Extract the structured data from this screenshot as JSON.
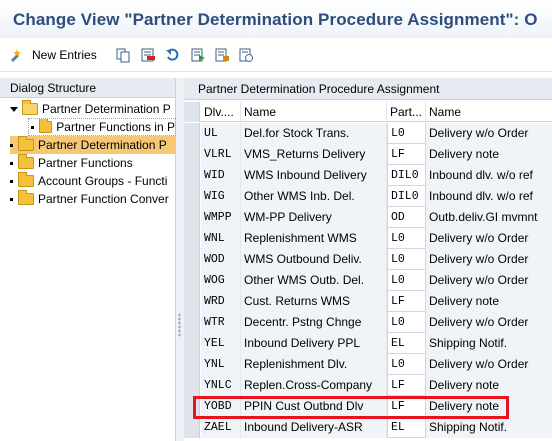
{
  "window": {
    "title": "Change View \"Partner Determination Procedure Assignment\": O"
  },
  "toolbar": {
    "new_entries_label": "New Entries",
    "icons": [
      "new-entries-icon",
      "copy-icon",
      "delete-icon",
      "undo-icon",
      "select-all-icon",
      "deselect-all-icon",
      "block-icon"
    ]
  },
  "dialog_structure": {
    "header": "Dialog Structure",
    "items": [
      {
        "label": "Partner Determination P",
        "level": 0,
        "expanded": true,
        "selected": false
      },
      {
        "label": "Partner Functions in P",
        "level": 1,
        "expanded": false,
        "selected": false
      },
      {
        "label": "Partner Determination P",
        "level": 0,
        "expanded": false,
        "selected": true
      },
      {
        "label": "Partner Functions",
        "level": 0,
        "expanded": false,
        "selected": false
      },
      {
        "label": "Account Groups - Functi",
        "level": 0,
        "expanded": false,
        "selected": false
      },
      {
        "label": "Partner Function Conver",
        "level": 0,
        "expanded": false,
        "selected": false
      }
    ]
  },
  "panel": {
    "header": "Partner Determination Procedure Assignment"
  },
  "table": {
    "columns": [
      "Dlv....",
      "Name",
      "Part...",
      "Name"
    ],
    "rows": [
      {
        "dlv": "UL",
        "name": "Del.for Stock Trans.",
        "part": "L0",
        "pname": "Delivery w/o Order"
      },
      {
        "dlv": "VLRL",
        "name": "VMS_Returns Delivery",
        "part": "LF",
        "pname": "Delivery note"
      },
      {
        "dlv": "WID",
        "name": "WMS Inbound Delivery",
        "part": "DIL0",
        "pname": "Inbound dlv. w/o ref"
      },
      {
        "dlv": "WIG",
        "name": "Other WMS Inb. Del.",
        "part": "DIL0",
        "pname": "Inbound dlv. w/o ref"
      },
      {
        "dlv": "WMPP",
        "name": "WM-PP Delivery",
        "part": "OD",
        "pname": "Outb.deliv.GI mvmnt"
      },
      {
        "dlv": "WNL",
        "name": "Replenishment WMS",
        "part": "L0",
        "pname": "Delivery w/o Order"
      },
      {
        "dlv": "WOD",
        "name": "WMS Outbound Deliv.",
        "part": "L0",
        "pname": "Delivery w/o Order"
      },
      {
        "dlv": "WOG",
        "name": "Other WMS Outb. Del.",
        "part": "L0",
        "pname": "Delivery w/o Order"
      },
      {
        "dlv": "WRD",
        "name": "Cust. Returns WMS",
        "part": "LF",
        "pname": "Delivery note"
      },
      {
        "dlv": "WTR",
        "name": "Decentr. Pstng Chnge",
        "part": "L0",
        "pname": "Delivery w/o Order"
      },
      {
        "dlv": "YEL",
        "name": "Inbound Delivery PPL",
        "part": "EL",
        "pname": "Shipping Notif."
      },
      {
        "dlv": "YNL",
        "name": "Replenishment Dlv.",
        "part": "L0",
        "pname": "Delivery w/o Order"
      },
      {
        "dlv": "YNLC",
        "name": "Replen.Cross-Company",
        "part": "LF",
        "pname": "Delivery note"
      },
      {
        "dlv": "YOBD",
        "name": "PPIN Cust Outbnd Dlv",
        "part": "LF",
        "pname": "Delivery note"
      },
      {
        "dlv": "ZAEL",
        "name": "Inbound Delivery-ASR",
        "part": "EL",
        "pname": "Shipping Notif."
      }
    ],
    "highlighted_row": "YOBD"
  },
  "colors": {
    "title": "#2d4e7b",
    "selected_tree_item": "#f5c876",
    "highlight_border": "#e8141b"
  }
}
